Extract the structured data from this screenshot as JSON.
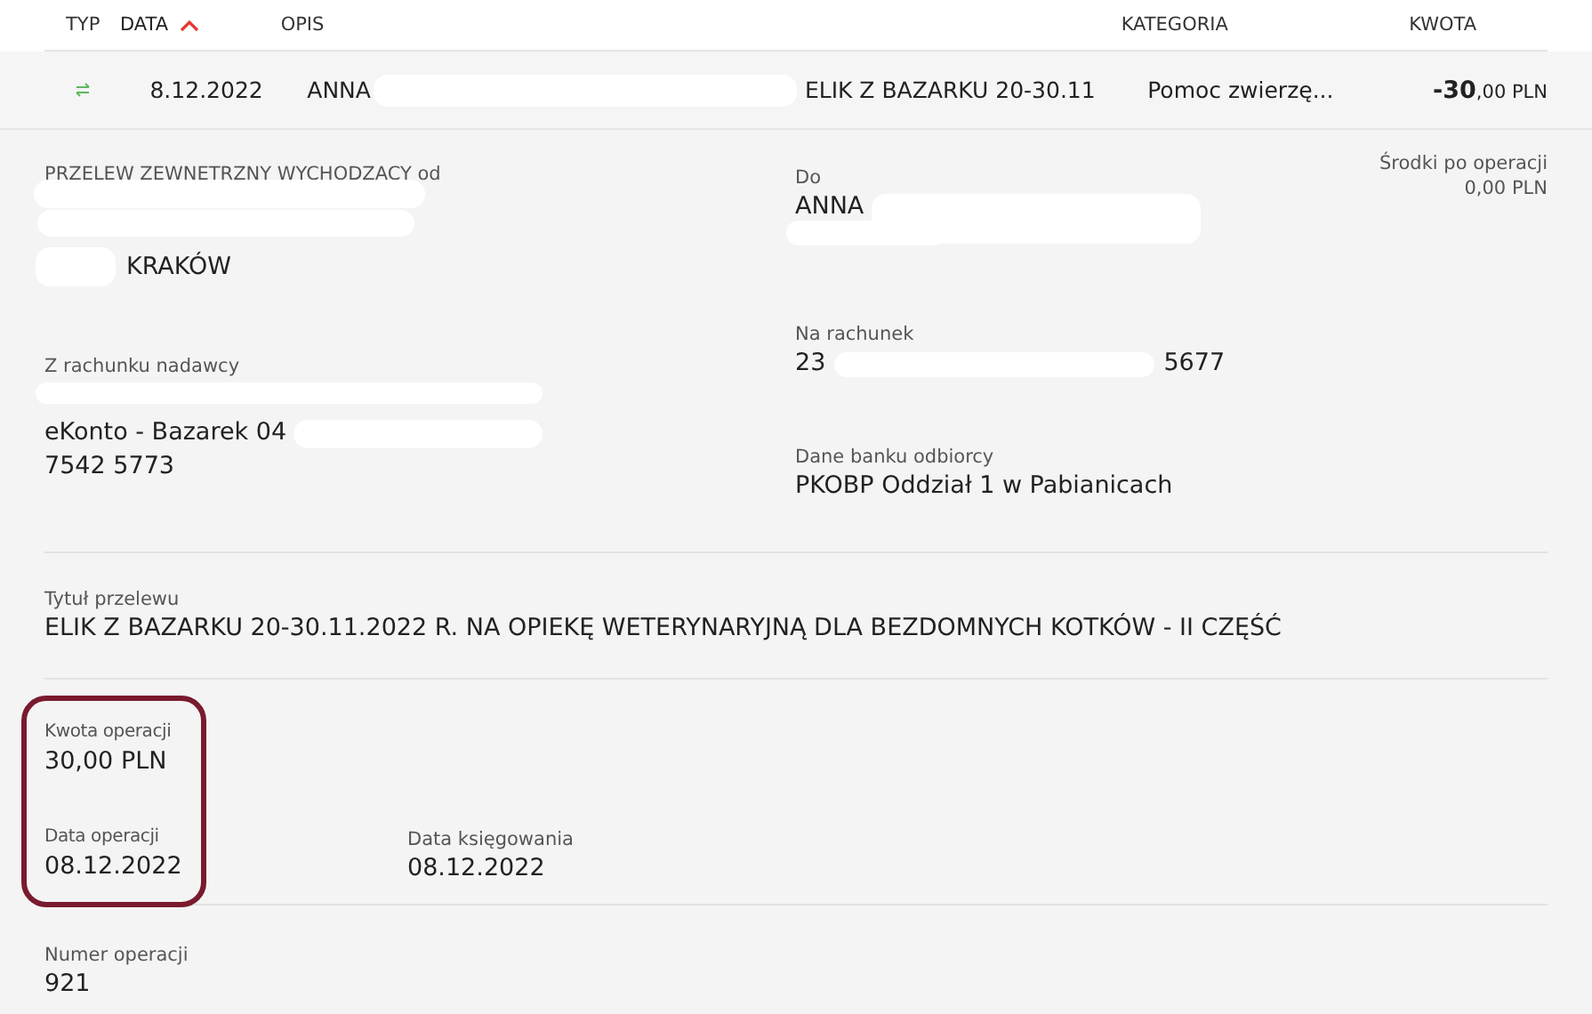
{
  "table": {
    "columns": [
      {
        "label": "TYP",
        "sorted": false
      },
      {
        "label": "DATA",
        "sorted": true
      },
      {
        "label": "OPIS",
        "sorted": false
      },
      {
        "label": "KATEGORIA",
        "sorted": false
      },
      {
        "label": "KWOTA",
        "sorted": false
      }
    ],
    "row": {
      "date": "8.12.2022",
      "description_start": "ANNA",
      "description_end": "ELIK Z BAZARKU 20-30.11",
      "category": "Pomoc zwierzę...",
      "amount_main": "-30",
      "amount_rest": ",00 PLN"
    }
  },
  "details": {
    "type_label": "PRZELEW ZEWNETRZNY WYCHODZACY od",
    "sender_city": "KRAKÓW",
    "from_account_label": "Z rachunku nadawcy",
    "from_account_name": "eKonto - Bazarek 04",
    "from_account_number": "7542 5773",
    "to_label": "Do",
    "to_name": "ANNA",
    "to_account_label": "Na rachunek",
    "to_account_start": "23",
    "to_account_end": "5677",
    "bank_label": "Dane banku odbiorcy",
    "bank_name": "PKOBP Oddział 1 w Pabianicach",
    "balance_label": "Środki po operacji",
    "balance": "0,00 PLN",
    "title_label": "Tytuł przelewu",
    "title": "ELIK Z BAZARKU 20-30.11.2022 R. NA OPIEKĘ WETERYNARYJNĄ DLA BEZDOMNYCH KOTKÓW - II CZĘŚĆ",
    "amount_label": "Kwota operacji",
    "amount": "30,00 PLN",
    "date_label": "Data operacji",
    "date": "08.12.2022",
    "booking_label": "Data księgowania",
    "booking_date": "08.12.2022",
    "number_label": "Numer operacji",
    "number": "921"
  }
}
